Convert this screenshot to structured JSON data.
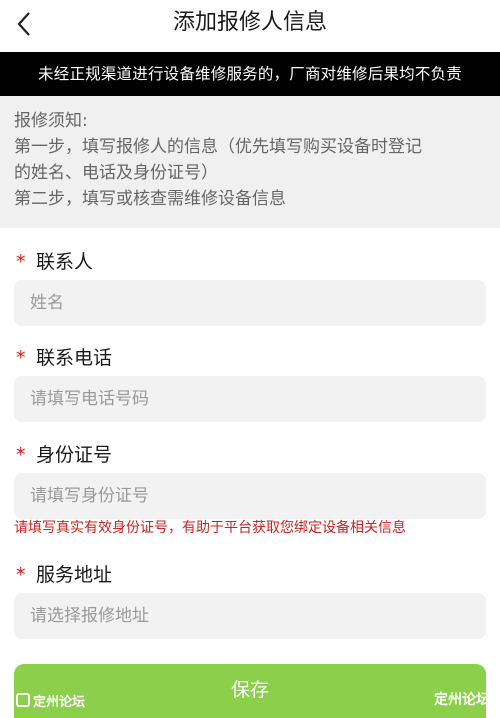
{
  "header": {
    "title": "添加报修人信息",
    "back_icon": "chevron-left-icon"
  },
  "warning": "未经正规渠道进行设备维修服务的，厂商对维修后果均不负责",
  "notice": {
    "lines": [
      "报修须知:",
      "第一步，填写报修人的信息（优先填写购买设备时登记",
      "的姓名、电话及身份证号）",
      "第二步，填写或核查需维修设备信息"
    ]
  },
  "form": {
    "required_mark": "*",
    "contact": {
      "label": "联系人",
      "placeholder": "姓名",
      "value": ""
    },
    "phone": {
      "label": "联系电话",
      "placeholder": "请填写电话号码",
      "value": ""
    },
    "id_number": {
      "label": "身份证号",
      "placeholder": "请填写身份证号",
      "value": ""
    },
    "id_hint": "请填写真实有效身份证号，有助于平台获取您绑定设备相关信息",
    "address": {
      "label": "服务地址",
      "placeholder": "请选择报修地址",
      "value": ""
    }
  },
  "save_label": "保存",
  "watermark": {
    "left": "定州论坛",
    "right": "定州论坛"
  },
  "colors": {
    "warning_bg": "#000000",
    "notice_bg": "#f0f0f0",
    "required": "#d21d1d",
    "hint": "#cc2222",
    "save_button": "#8ccf4a"
  }
}
